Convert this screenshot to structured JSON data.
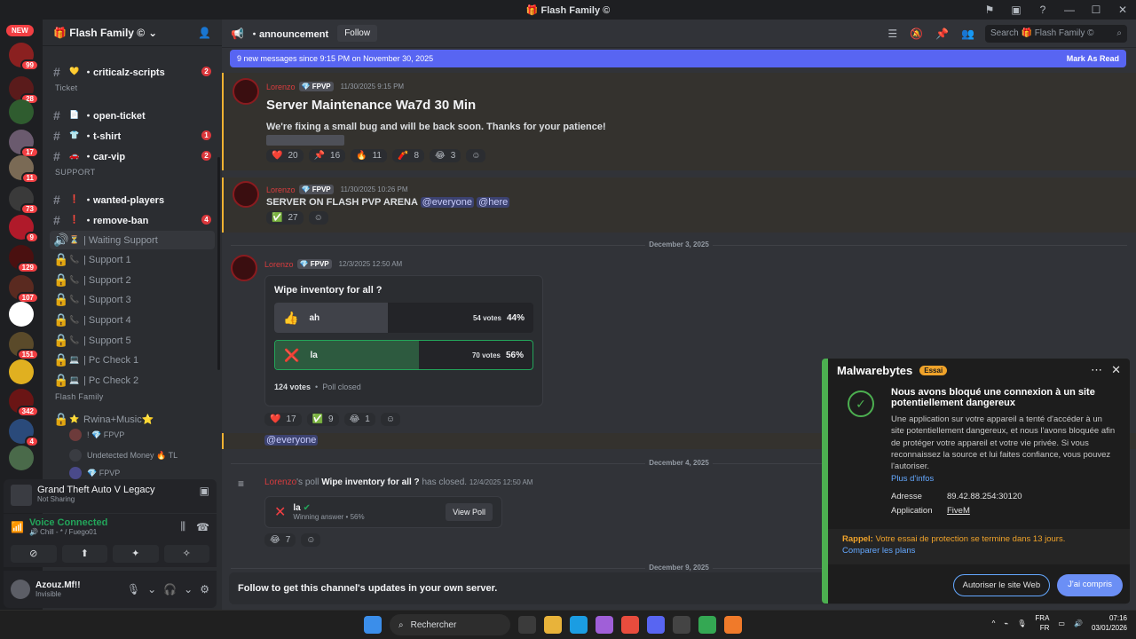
{
  "window": {
    "title": "🎁 Flash Family ©"
  },
  "server": {
    "name": "🎁 Flash Family ©",
    "new_badge": "NEW",
    "badges": [
      "99",
      "28",
      "17",
      "11",
      "73",
      "9",
      "129",
      "107",
      "151",
      "342",
      "4"
    ]
  },
  "channels": [
    {
      "emoji": "💛",
      "name": "・criticalz-scripts",
      "count": "2",
      "unread": true
    },
    {
      "category": "Ticket"
    },
    {
      "emoji": "📄",
      "name": "・open-ticket",
      "unread": true
    },
    {
      "emoji": "👕",
      "name": "・t-shirt",
      "count": "1",
      "unread": true
    },
    {
      "emoji": "🚗",
      "name": "・car-vip",
      "count": "2",
      "unread": true
    },
    {
      "category": "SUPPORT"
    },
    {
      "emoji": "❗",
      "name": "・wanted-players",
      "unread": true
    },
    {
      "emoji": "❗",
      "name": "・remove-ban",
      "count": "4",
      "unread": true
    },
    {
      "emoji": "⏳",
      "name": "| Waiting Support",
      "voice": true
    },
    {
      "emoji": "📞",
      "name": "| Support 1"
    },
    {
      "emoji": "📞",
      "name": "| Support 2"
    },
    {
      "emoji": "📞",
      "name": "| Support 3"
    },
    {
      "emoji": "📞",
      "name": "| Support 4"
    },
    {
      "emoji": "📞",
      "name": "| Support 5"
    },
    {
      "emoji": "💻",
      "name": "| Pc Check 1"
    },
    {
      "emoji": "💻",
      "name": "| Pc Check 2"
    },
    {
      "category": "Flash Family"
    },
    {
      "emoji": "⭐",
      "name": "Rwina+Music⭐"
    }
  ],
  "voice_users": [
    {
      "name": "! 💎 FPVP"
    },
    {
      "name": "Undetected Money 🔥 TL"
    },
    {
      "name": "💎 FPVP"
    }
  ],
  "activity": {
    "game": "Grand Theft Auto V Legacy",
    "status": "Not Sharing"
  },
  "voice": {
    "status": "Voice Connected",
    "channel": "🔊 Chill - * / Fuego01"
  },
  "user": {
    "name": "Azouz.Mf!!",
    "status": "Invisible"
  },
  "channel": {
    "name": "・announcement",
    "follow": "Follow",
    "search_placeholder": "Search 🎁 Flash Family ©"
  },
  "newbar": {
    "text": "9 new messages since 9:15 PM on November 30, 2025",
    "action": "Mark As Read"
  },
  "messages": [
    {
      "username": "Lorenzo",
      "tag": "💎 FPVP",
      "time": "11/30/2025 9:15 PM",
      "title": "Server Maintenance Wa7d 30 Min",
      "text": "We're fixing a small bug and will be back soon. Thanks for your patience!",
      "reactions": [
        {
          "e": "❤️",
          "c": "20"
        },
        {
          "e": "📌",
          "c": "16"
        },
        {
          "e": "🔥",
          "c": "11"
        },
        {
          "e": "🧨",
          "c": "8"
        },
        {
          "e": "😂",
          "c": "3"
        }
      ]
    },
    {
      "username": "Lorenzo",
      "tag": "💎 FPVP",
      "time": "11/30/2025 10:26 PM",
      "text": "SERVER ON FLASH PVP ARENA",
      "mentions": [
        "@everyone",
        "@here"
      ],
      "reactions": [
        {
          "e": "✅",
          "c": "27"
        }
      ]
    },
    {
      "date": "December 3, 2025"
    },
    {
      "username": "Lorenzo",
      "tag": "💎 FPVP",
      "time": "12/3/2025 12:50 AM"
    }
  ],
  "poll": {
    "question": "Wipe inventory for all ?",
    "options": [
      {
        "icon": "👍",
        "label": "ah",
        "votes": "54 votes",
        "pct": "44%",
        "share": 0.44
      },
      {
        "icon": "❌",
        "label": "la",
        "votes": "70 votes",
        "pct": "56%",
        "share": 0.56,
        "winner": true
      }
    ],
    "total": "124 votes",
    "status": "Poll closed",
    "reactions": [
      {
        "e": "❤️",
        "c": "17"
      },
      {
        "e": "✅",
        "c": "9"
      },
      {
        "e": "😂",
        "c": "1"
      }
    ],
    "mention": "@everyone"
  },
  "dates": {
    "d2": "December 4, 2025",
    "d3": "December 9, 2025"
  },
  "poll_result": {
    "user": "Lorenzo",
    "text_a": "'s poll",
    "question": "Wipe inventory for all ?",
    "text_b": "has closed.",
    "time": "12/4/2025 12:50 AM",
    "answer": "la",
    "winning": "Winning answer • 56%",
    "view": "View Poll",
    "reaction": {
      "e": "😂",
      "c": "7"
    }
  },
  "followbar": "Follow to get this channel's updates in your own server.",
  "malwarebytes": {
    "logo": "Malwarebytes",
    "trial": "Essai",
    "title": "Nous avons bloqué une connexion à un site potentiellement dangereux",
    "body": "Une application sur votre appareil a tenté d'accéder à un site potentiellement dangereux, et nous l'avons bloquée afin de protéger votre appareil et votre vie privée. Si vous reconnaissez la source et lui faites confiance, vous pouvez l'autoriser.",
    "more": "Plus d'infos",
    "address_label": "Adresse",
    "address": "89.42.88.254:30120",
    "app_label": "Application",
    "app": "FiveM",
    "reminder_label": "Rappel:",
    "reminder": "Votre essai de protection se termine dans 13 jours.",
    "compare": "Comparer les plans",
    "allow": "Autoriser le site Web",
    "ok": "J'ai compris",
    "accent": "#4caf50"
  },
  "taskbar": {
    "search": "Rechercher",
    "lang": "FRA",
    "lang2": "FR",
    "time": "07:16",
    "date": "03/01/2026"
  }
}
